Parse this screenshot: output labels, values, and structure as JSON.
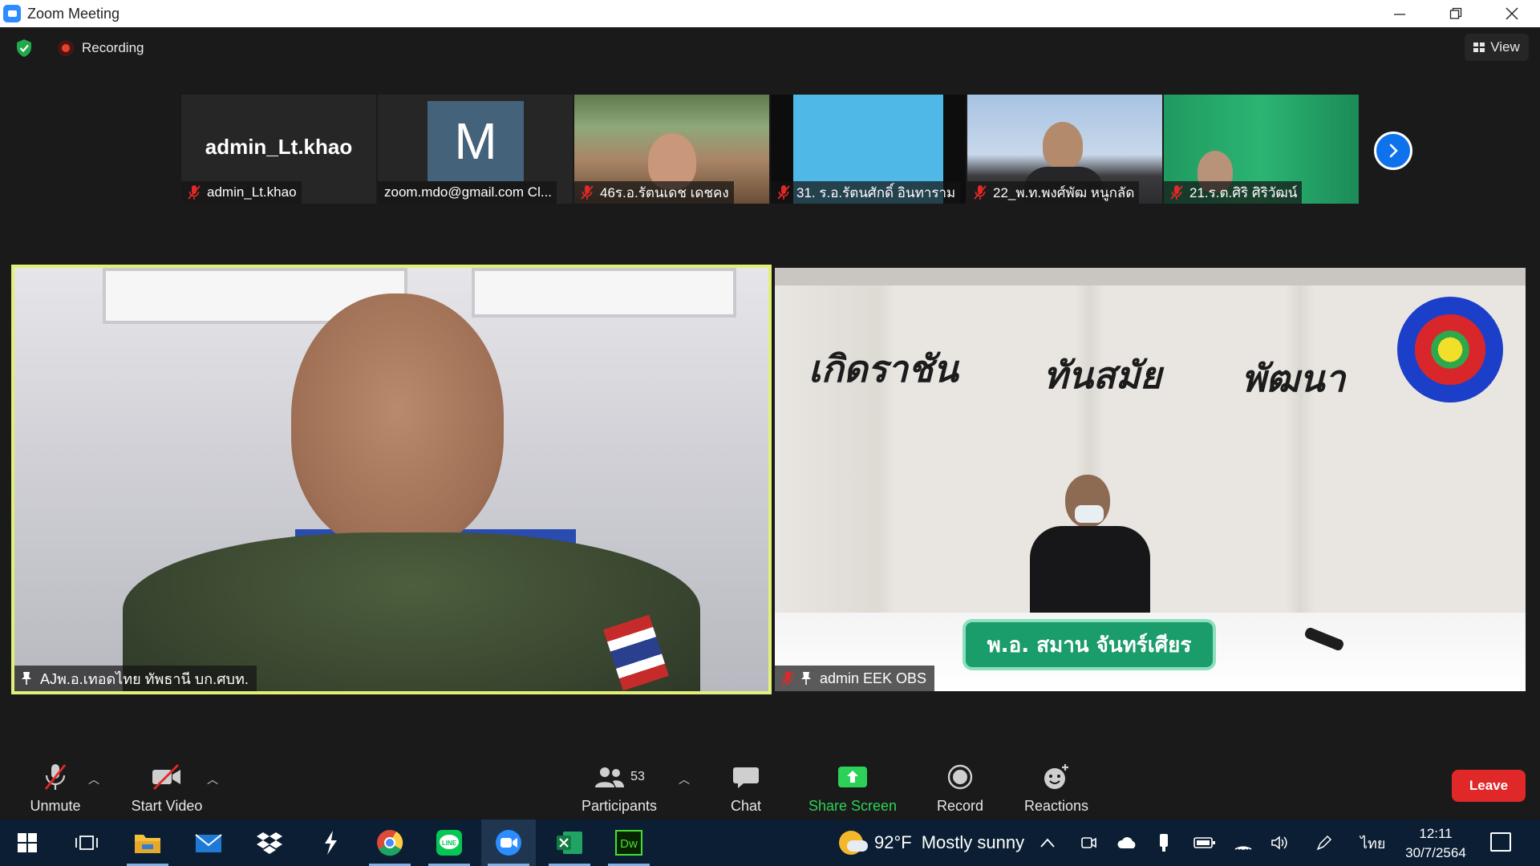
{
  "window": {
    "title": "Zoom Meeting",
    "controls": [
      "minimize",
      "restore",
      "close"
    ]
  },
  "header": {
    "recording_label": "Recording",
    "view_label": "View"
  },
  "thumbnails": [
    {
      "display_name": "admin_Lt.khao",
      "label": "admin_Lt.khao",
      "muted": true
    },
    {
      "avatar_letter": "M",
      "label": "zoom.mdo@gmail.com Cl...",
      "muted": false
    },
    {
      "label": "46ร.อ.รัตนเดช เดชคง",
      "muted": true
    },
    {
      "label": "31. ร.อ.รัตนศักดิ์ อินทาราม",
      "muted": true
    },
    {
      "label": "22_พ.ท.พงศ์พัฒ หนูกลัด",
      "muted": true
    },
    {
      "label": "21.ร.ต.ศิริ ศิริวัฒน์",
      "muted": true
    }
  ],
  "main_videos": {
    "left": {
      "label": "AJพ.อ.เทอดไทย ทัพธานี บก.ศบท."
    },
    "right": {
      "label": "admin EEK OBS",
      "wall_words": [
        "เกิดราชัน",
        "ทันสมัย",
        "พัฒนา"
      ],
      "nameplate": "พ.อ. สมาน จันทร์เศียร"
    }
  },
  "toolbar": {
    "unmute": "Unmute",
    "start_video": "Start Video",
    "participants": "Participants",
    "participants_count": "53",
    "chat": "Chat",
    "share_screen": "Share Screen",
    "record": "Record",
    "reactions": "Reactions",
    "leave": "Leave"
  },
  "taskbar": {
    "apps": [
      "start",
      "task-view",
      "file-explorer",
      "mail",
      "dropbox",
      "app-s",
      "chrome",
      "line",
      "zoom",
      "excel",
      "dreamweaver"
    ],
    "weather_temp": "92°F",
    "weather_text": "Mostly sunny",
    "language": "ไทย",
    "time": "12:11",
    "date": "30/7/2564"
  },
  "colors": {
    "active_speaker_border": "#e2f07a",
    "share_green": "#2ed158",
    "leave_red": "#e02828",
    "zoom_blue": "#0e72ed"
  }
}
